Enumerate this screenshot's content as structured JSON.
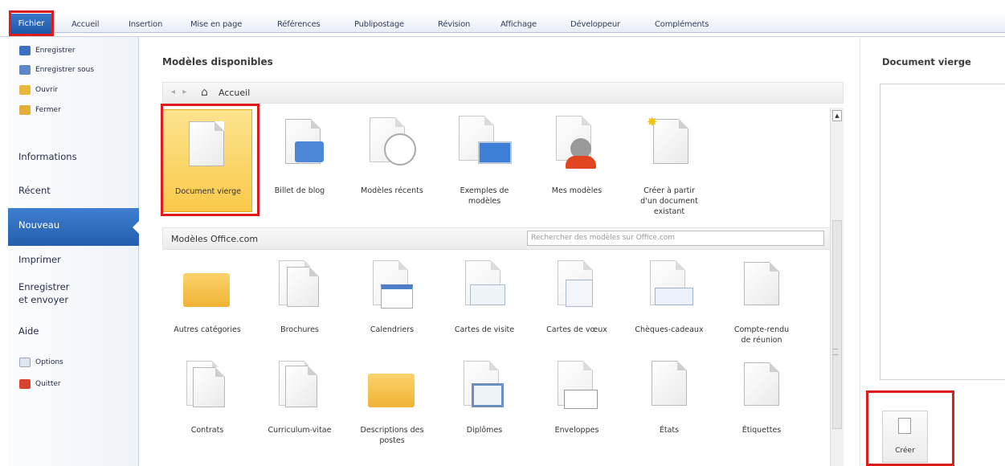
{
  "tabs": {
    "fichier": "Fichier",
    "items": [
      "Accueil",
      "Insertion",
      "Mise en page",
      "Références",
      "Publipostage",
      "Révision",
      "Affichage",
      "Développeur",
      "Compléments"
    ]
  },
  "leftnav": {
    "small_top": [
      "Enregistrer",
      "Enregistrer sous",
      "Ouvrir",
      "Fermer"
    ],
    "informations": "Informations",
    "recent": "Récent",
    "nouveau": "Nouveau",
    "imprimer": "Imprimer",
    "enregistrer_envoyer_1": "Enregistrer",
    "enregistrer_envoyer_2": "et envoyer",
    "aide": "Aide",
    "options": "Options",
    "quitter": "Quitter"
  },
  "main": {
    "title": "Modèles disponibles",
    "breadcrumb": "Accueil",
    "top_tiles": [
      {
        "l1": "Document vierge",
        "l2": "",
        "l3": ""
      },
      {
        "l1": "Billet de blog",
        "l2": "",
        "l3": ""
      },
      {
        "l1": "Modèles récents",
        "l2": "",
        "l3": ""
      },
      {
        "l1": "Exemples de",
        "l2": "modèles",
        "l3": ""
      },
      {
        "l1": "Mes modèles",
        "l2": "",
        "l3": ""
      },
      {
        "l1": "Créer à partir",
        "l2": "d'un document",
        "l3": "existant"
      }
    ],
    "office_title": "Modèles Office.com",
    "search_placeholder": "Rechercher des modèles sur Office.com",
    "search_button": "➔",
    "office_row1": [
      {
        "l1": "Autres catégories",
        "l2": ""
      },
      {
        "l1": "Brochures",
        "l2": ""
      },
      {
        "l1": "Calendriers",
        "l2": ""
      },
      {
        "l1": "Cartes de visite",
        "l2": ""
      },
      {
        "l1": "Cartes de vœux",
        "l2": ""
      },
      {
        "l1": "Chèques-cadeaux",
        "l2": ""
      },
      {
        "l1": "Compte-rendu",
        "l2": "de réunion"
      }
    ],
    "office_row2": [
      {
        "l1": "Contrats",
        "l2": ""
      },
      {
        "l1": "Curriculum-vitae",
        "l2": ""
      },
      {
        "l1": "Descriptions des",
        "l2": "postes"
      },
      {
        "l1": "Diplômes",
        "l2": ""
      },
      {
        "l1": "Enveloppes",
        "l2": ""
      },
      {
        "l1": "États",
        "l2": ""
      },
      {
        "l1": "Étiquettes",
        "l2": ""
      }
    ]
  },
  "right": {
    "title": "Document vierge",
    "create": "Créer"
  },
  "colors": {
    "accent": "#2b65b7",
    "highlight": "#f9c94a",
    "annotation": "#e01b1b"
  }
}
